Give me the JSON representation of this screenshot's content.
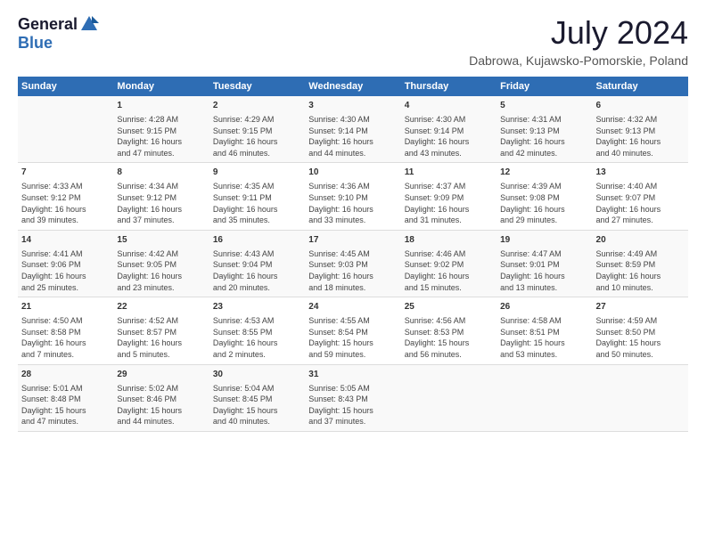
{
  "logo": {
    "general": "General",
    "blue": "Blue"
  },
  "title": "July 2024",
  "location": "Dabrowa, Kujawsko-Pomorskie, Poland",
  "days_header": [
    "Sunday",
    "Monday",
    "Tuesday",
    "Wednesday",
    "Thursday",
    "Friday",
    "Saturday"
  ],
  "rows": [
    [
      {
        "day": "",
        "lines": []
      },
      {
        "day": "1",
        "lines": [
          "Sunrise: 4:28 AM",
          "Sunset: 9:15 PM",
          "Daylight: 16 hours",
          "and 47 minutes."
        ]
      },
      {
        "day": "2",
        "lines": [
          "Sunrise: 4:29 AM",
          "Sunset: 9:15 PM",
          "Daylight: 16 hours",
          "and 46 minutes."
        ]
      },
      {
        "day": "3",
        "lines": [
          "Sunrise: 4:30 AM",
          "Sunset: 9:14 PM",
          "Daylight: 16 hours",
          "and 44 minutes."
        ]
      },
      {
        "day": "4",
        "lines": [
          "Sunrise: 4:30 AM",
          "Sunset: 9:14 PM",
          "Daylight: 16 hours",
          "and 43 minutes."
        ]
      },
      {
        "day": "5",
        "lines": [
          "Sunrise: 4:31 AM",
          "Sunset: 9:13 PM",
          "Daylight: 16 hours",
          "and 42 minutes."
        ]
      },
      {
        "day": "6",
        "lines": [
          "Sunrise: 4:32 AM",
          "Sunset: 9:13 PM",
          "Daylight: 16 hours",
          "and 40 minutes."
        ]
      }
    ],
    [
      {
        "day": "7",
        "lines": [
          "Sunrise: 4:33 AM",
          "Sunset: 9:12 PM",
          "Daylight: 16 hours",
          "and 39 minutes."
        ]
      },
      {
        "day": "8",
        "lines": [
          "Sunrise: 4:34 AM",
          "Sunset: 9:12 PM",
          "Daylight: 16 hours",
          "and 37 minutes."
        ]
      },
      {
        "day": "9",
        "lines": [
          "Sunrise: 4:35 AM",
          "Sunset: 9:11 PM",
          "Daylight: 16 hours",
          "and 35 minutes."
        ]
      },
      {
        "day": "10",
        "lines": [
          "Sunrise: 4:36 AM",
          "Sunset: 9:10 PM",
          "Daylight: 16 hours",
          "and 33 minutes."
        ]
      },
      {
        "day": "11",
        "lines": [
          "Sunrise: 4:37 AM",
          "Sunset: 9:09 PM",
          "Daylight: 16 hours",
          "and 31 minutes."
        ]
      },
      {
        "day": "12",
        "lines": [
          "Sunrise: 4:39 AM",
          "Sunset: 9:08 PM",
          "Daylight: 16 hours",
          "and 29 minutes."
        ]
      },
      {
        "day": "13",
        "lines": [
          "Sunrise: 4:40 AM",
          "Sunset: 9:07 PM",
          "Daylight: 16 hours",
          "and 27 minutes."
        ]
      }
    ],
    [
      {
        "day": "14",
        "lines": [
          "Sunrise: 4:41 AM",
          "Sunset: 9:06 PM",
          "Daylight: 16 hours",
          "and 25 minutes."
        ]
      },
      {
        "day": "15",
        "lines": [
          "Sunrise: 4:42 AM",
          "Sunset: 9:05 PM",
          "Daylight: 16 hours",
          "and 23 minutes."
        ]
      },
      {
        "day": "16",
        "lines": [
          "Sunrise: 4:43 AM",
          "Sunset: 9:04 PM",
          "Daylight: 16 hours",
          "and 20 minutes."
        ]
      },
      {
        "day": "17",
        "lines": [
          "Sunrise: 4:45 AM",
          "Sunset: 9:03 PM",
          "Daylight: 16 hours",
          "and 18 minutes."
        ]
      },
      {
        "day": "18",
        "lines": [
          "Sunrise: 4:46 AM",
          "Sunset: 9:02 PM",
          "Daylight: 16 hours",
          "and 15 minutes."
        ]
      },
      {
        "day": "19",
        "lines": [
          "Sunrise: 4:47 AM",
          "Sunset: 9:01 PM",
          "Daylight: 16 hours",
          "and 13 minutes."
        ]
      },
      {
        "day": "20",
        "lines": [
          "Sunrise: 4:49 AM",
          "Sunset: 8:59 PM",
          "Daylight: 16 hours",
          "and 10 minutes."
        ]
      }
    ],
    [
      {
        "day": "21",
        "lines": [
          "Sunrise: 4:50 AM",
          "Sunset: 8:58 PM",
          "Daylight: 16 hours",
          "and 7 minutes."
        ]
      },
      {
        "day": "22",
        "lines": [
          "Sunrise: 4:52 AM",
          "Sunset: 8:57 PM",
          "Daylight: 16 hours",
          "and 5 minutes."
        ]
      },
      {
        "day": "23",
        "lines": [
          "Sunrise: 4:53 AM",
          "Sunset: 8:55 PM",
          "Daylight: 16 hours",
          "and 2 minutes."
        ]
      },
      {
        "day": "24",
        "lines": [
          "Sunrise: 4:55 AM",
          "Sunset: 8:54 PM",
          "Daylight: 15 hours",
          "and 59 minutes."
        ]
      },
      {
        "day": "25",
        "lines": [
          "Sunrise: 4:56 AM",
          "Sunset: 8:53 PM",
          "Daylight: 15 hours",
          "and 56 minutes."
        ]
      },
      {
        "day": "26",
        "lines": [
          "Sunrise: 4:58 AM",
          "Sunset: 8:51 PM",
          "Daylight: 15 hours",
          "and 53 minutes."
        ]
      },
      {
        "day": "27",
        "lines": [
          "Sunrise: 4:59 AM",
          "Sunset: 8:50 PM",
          "Daylight: 15 hours",
          "and 50 minutes."
        ]
      }
    ],
    [
      {
        "day": "28",
        "lines": [
          "Sunrise: 5:01 AM",
          "Sunset: 8:48 PM",
          "Daylight: 15 hours",
          "and 47 minutes."
        ]
      },
      {
        "day": "29",
        "lines": [
          "Sunrise: 5:02 AM",
          "Sunset: 8:46 PM",
          "Daylight: 15 hours",
          "and 44 minutes."
        ]
      },
      {
        "day": "30",
        "lines": [
          "Sunrise: 5:04 AM",
          "Sunset: 8:45 PM",
          "Daylight: 15 hours",
          "and 40 minutes."
        ]
      },
      {
        "day": "31",
        "lines": [
          "Sunrise: 5:05 AM",
          "Sunset: 8:43 PM",
          "Daylight: 15 hours",
          "and 37 minutes."
        ]
      },
      {
        "day": "",
        "lines": []
      },
      {
        "day": "",
        "lines": []
      },
      {
        "day": "",
        "lines": []
      }
    ]
  ]
}
